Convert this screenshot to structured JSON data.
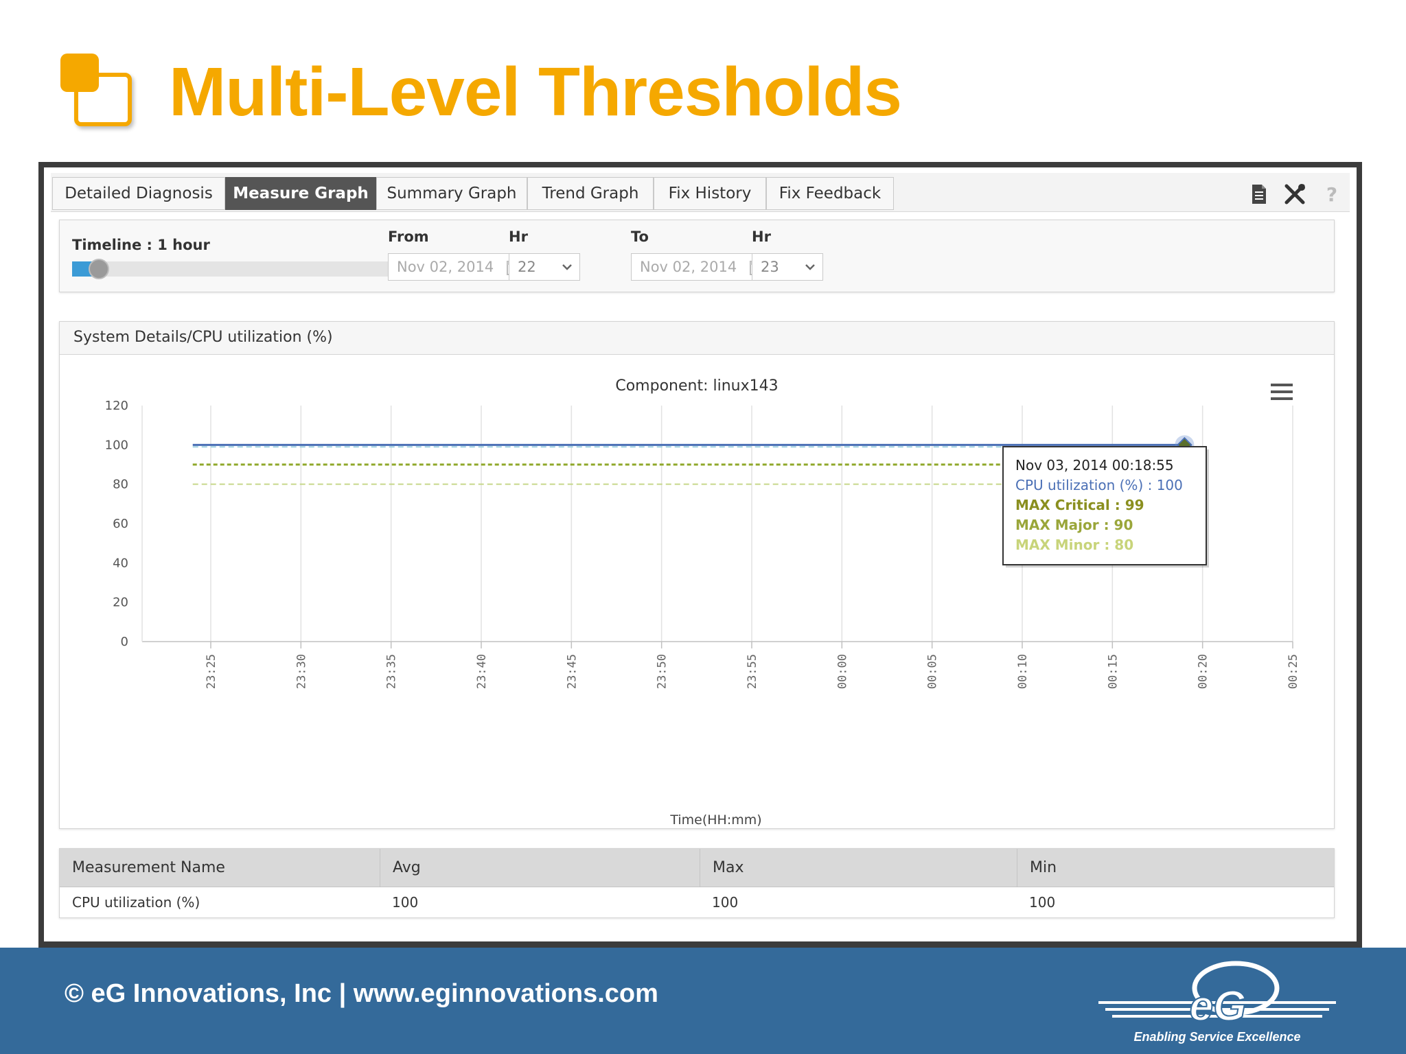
{
  "slide": {
    "title": "Multi-Level Thresholds"
  },
  "tabs": [
    {
      "label": "Detailed Diagnosis",
      "active": false
    },
    {
      "label": "Measure Graph",
      "active": true
    },
    {
      "label": "Summary Graph",
      "active": false
    },
    {
      "label": "Trend Graph",
      "active": false
    },
    {
      "label": "Fix History",
      "active": false
    },
    {
      "label": "Fix Feedback",
      "active": false
    }
  ],
  "toolbar": {
    "icons": [
      "document-icon",
      "tools-icon",
      "help-icon"
    ],
    "help_glyph": "?"
  },
  "timeline": {
    "label": "Timeline : 1 hour",
    "slider_level": 0.05,
    "from_label": "From",
    "from_date": "Nov 02, 2014",
    "from_hr_label": "Hr",
    "from_hr": "22",
    "to_label": "To",
    "to_date": "Nov 02, 2014",
    "to_hr_label": "Hr",
    "to_hr": "23"
  },
  "graph_panel": {
    "header": "System Details/CPU utilization (%)"
  },
  "chart_data": {
    "type": "line",
    "title": "Component: linux143",
    "xlabel": "Time(HH:mm)",
    "ylabel": "",
    "ylim": [
      0,
      120
    ],
    "yticks": [
      0,
      20,
      40,
      60,
      80,
      100,
      120
    ],
    "xticks": [
      "23:25",
      "23:30",
      "23:35",
      "23:40",
      "23:45",
      "23:50",
      "23:55",
      "00:00",
      "00:05",
      "00:10",
      "00:15",
      "00:20",
      "00:25"
    ],
    "grid": true,
    "series": [
      {
        "name": "CPU utilization (%)",
        "value": 100,
        "from": "23:24",
        "to": "00:19",
        "color": "#4a6fb5",
        "style": "solid"
      },
      {
        "name": "MAX Critical",
        "value": 99,
        "from": "23:24",
        "to": "00:19",
        "color": "#9fd0e0",
        "style": "dashed"
      },
      {
        "name": "MAX Major",
        "value": 90,
        "from": "23:24",
        "to": "00:19",
        "color": "#8fa82a",
        "style": "dotted"
      },
      {
        "name": "MAX Minor",
        "value": 80,
        "from": "23:24",
        "to": "00:19",
        "color": "#c6d88a",
        "style": "dashed"
      }
    ],
    "tooltip": {
      "time": "Nov 03, 2014 00:18:55",
      "lines": [
        {
          "text": "CPU utilization (%) : 100",
          "color": "#4a6fb5"
        },
        {
          "text": "MAX Critical : 99",
          "color": "#8a8f1f"
        },
        {
          "text": "MAX Major : 90",
          "color": "#9aa63a"
        },
        {
          "text": "MAX Minor : 80",
          "color": "#c8d47a"
        }
      ]
    },
    "menu_icon": "hamburger-menu-icon"
  },
  "table": {
    "headers": [
      "Measurement Name",
      "Avg",
      "Max",
      "Min"
    ],
    "rows": [
      [
        "CPU utilization (%)",
        "100",
        "100",
        "100"
      ]
    ]
  },
  "footer": {
    "text": "© eG Innovations, Inc  |  www.eginnovations.com",
    "logo_text": "eG",
    "tagline": "Enabling Service Excellence"
  }
}
